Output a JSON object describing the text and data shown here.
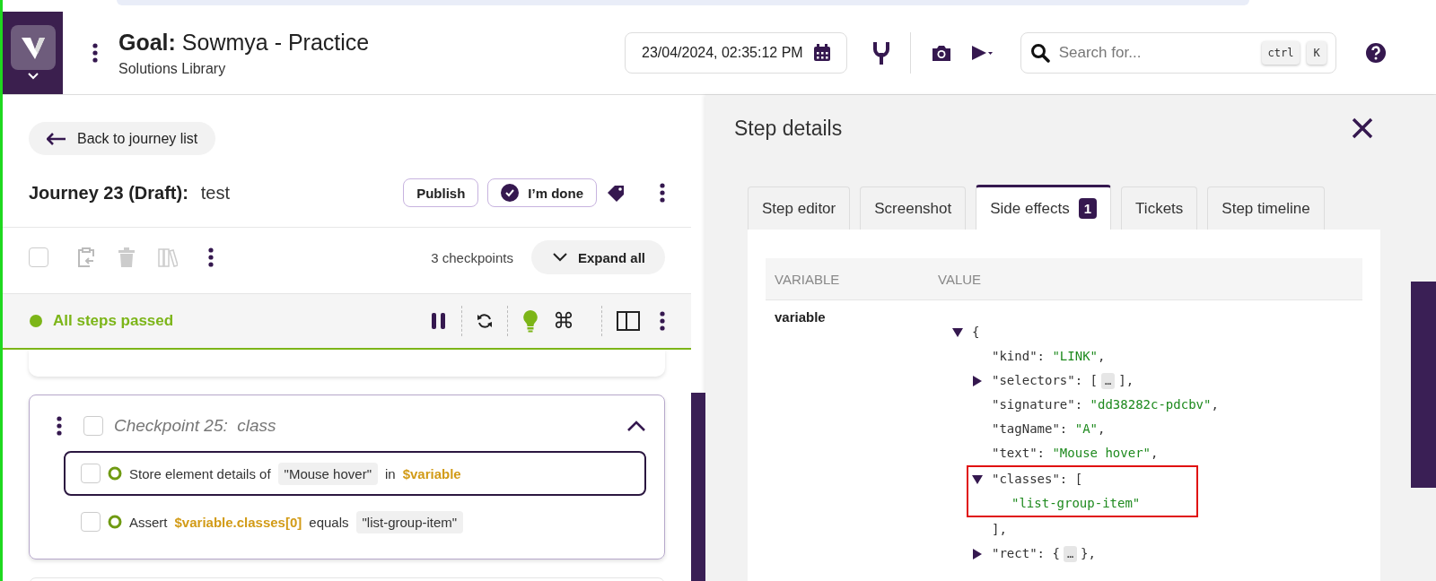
{
  "header": {
    "goal_label": "Goal:",
    "goal_name": "Sowmya - Practice",
    "subtitle": "Solutions Library",
    "datetime": "23/04/2024, 02:35:12 PM",
    "search": {
      "placeholder": "Search for...",
      "keys": [
        "ctrl",
        "K"
      ]
    }
  },
  "journey": {
    "select_all_checked": false,
    "back": "Back to journey list",
    "title_label": "Journey 23 (Draft):",
    "title": "test",
    "publish": "Publish",
    "done": "I’m done",
    "count": "3 checkpoints",
    "expand": "Expand all"
  },
  "status": {
    "text": "All steps passed",
    "command_key": "⌘"
  },
  "checkpoints": [
    {
      "title": "Checkpoint 25:  class",
      "checked": false,
      "expanded": true,
      "steps": [
        {
          "selected": true,
          "checked": false,
          "segments": [
            {
              "kind": "text",
              "text": "Store element details of"
            },
            {
              "kind": "chip",
              "text": "\"Mouse hover\""
            },
            {
              "kind": "text",
              "text": "in"
            },
            {
              "kind": "var",
              "text": "$variable"
            }
          ]
        },
        {
          "selected": false,
          "checked": false,
          "segments": [
            {
              "kind": "text",
              "text": "Assert"
            },
            {
              "kind": "var",
              "text": "$variable.classes[0]"
            },
            {
              "kind": "text",
              "text": "equals"
            },
            {
              "kind": "chip",
              "text": "\"list-group-item\""
            }
          ]
        }
      ]
    }
  ],
  "step_details": {
    "title": "Step details",
    "tabs": [
      {
        "label": "Step editor",
        "selected": false
      },
      {
        "label": "Screenshot",
        "selected": false
      },
      {
        "label": "Side effects",
        "selected": true,
        "badge": "1"
      },
      {
        "label": "Tickets",
        "selected": false
      },
      {
        "label": "Step timeline",
        "selected": false
      }
    ],
    "columns": [
      "VARIABLE",
      "VALUE"
    ],
    "rows": [
      {
        "variable": "variable",
        "value": {
          "open": "{",
          "expanded": true,
          "children": [
            {
              "key": "\"kind\"",
              "sep": ":",
              "value": "\"LINK\"",
              "after": ","
            },
            {
              "key": "\"selectors\"",
              "sep": ":",
              "open": "[",
              "expanded": false,
              "ellipsis": "…",
              "close": "]",
              "after": ","
            },
            {
              "key": "\"signature\"",
              "sep": ":",
              "value": "\"dd38282c-pdcbv\"",
              "after": ","
            },
            {
              "key": "\"tagName\"",
              "sep": ":",
              "value": "\"A\"",
              "after": ","
            },
            {
              "key": "\"text\"",
              "sep": ":",
              "value": "\"Mouse hover\"",
              "after": ","
            },
            {
              "key": "\"classes\"",
              "sep": ":",
              "open": "[",
              "expanded": true,
              "highlighted": true,
              "children": [
                {
                  "value": "\"list-group-item\""
                }
              ],
              "close": "]",
              "after": ","
            },
            {
              "key": "\"rect\"",
              "sep": ":",
              "open": "{",
              "expanded": false,
              "ellipsis": "…",
              "close": "}",
              "after": ","
            }
          ]
        }
      }
    ]
  }
}
